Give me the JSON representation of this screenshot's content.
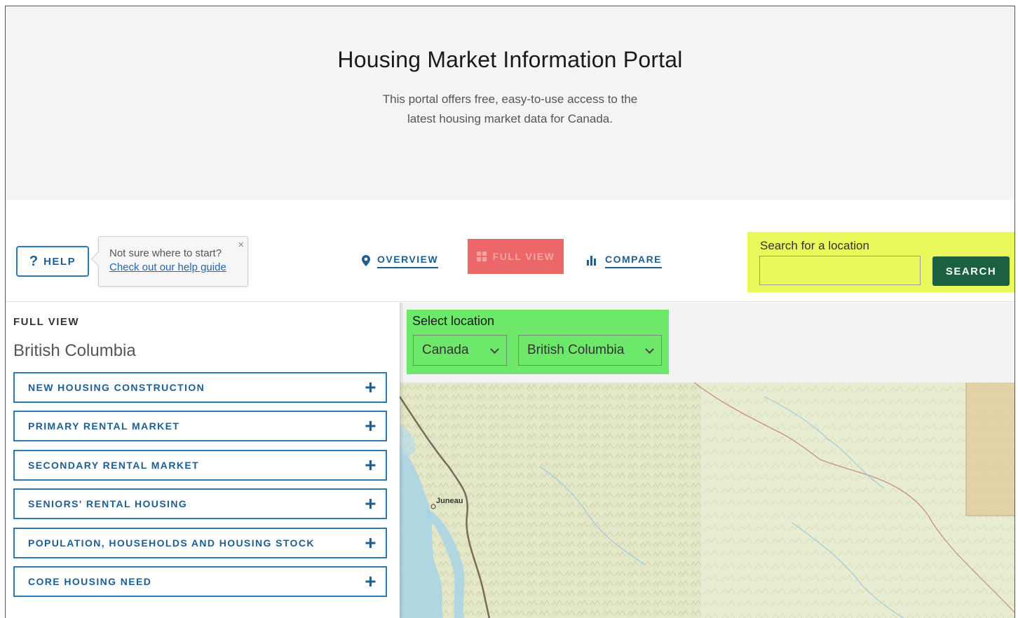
{
  "hero": {
    "title": "Housing Market Information Portal",
    "subtitle_line1": "This portal offers free, easy-to-use access to the",
    "subtitle_line2": "latest housing market data for Canada."
  },
  "toolbar": {
    "help_label": "HELP",
    "help_icon": "?",
    "tip_text": "Not sure where to start?",
    "tip_link": "Check out our help guide",
    "tip_close": "×",
    "nav": {
      "overview": "OVERVIEW",
      "full_view": "FULL VIEW",
      "compare": "COMPARE"
    },
    "search": {
      "label": "Search for a location",
      "value": "",
      "button": "SEARCH"
    }
  },
  "panel": {
    "caption": "FULL VIEW",
    "region": "British Columbia",
    "sections": [
      "NEW HOUSING CONSTRUCTION",
      "PRIMARY RENTAL MARKET",
      "SECONDARY RENTAL MARKET",
      "SENIORS' RENTAL HOUSING",
      "POPULATION, HOUSEHOLDS AND HOUSING STOCK",
      "CORE HOUSING NEED"
    ],
    "expand_symbol": "+"
  },
  "location": {
    "label": "Select location",
    "country": "Canada",
    "province": "British Columbia"
  },
  "map": {
    "place_label": "Juneau"
  },
  "colors": {
    "brand_blue": "#1d5e93",
    "search_green": "#1b6040",
    "highlight_yellow": "#e9f85a",
    "highlight_green": "#6ee86a",
    "highlight_red": "#ec6868"
  }
}
